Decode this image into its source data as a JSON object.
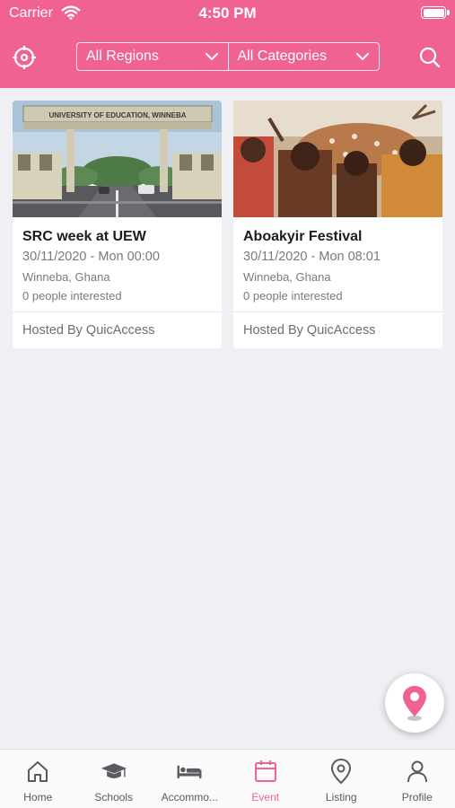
{
  "status_bar": {
    "carrier": "Carrier",
    "time": "4:50 PM"
  },
  "header": {
    "region_filter": "All Regions",
    "category_filter": "All Categories"
  },
  "events": [
    {
      "title": "SRC week at UEW",
      "datetime": "30/11/2020 - Mon 00:00",
      "location": "Winneba, Ghana",
      "interest": "0 people interested",
      "host": "Hosted By QuicAccess",
      "sign_text": "UNIVERSITY OF EDUCATION, WINNEBA"
    },
    {
      "title": "Aboakyir Festival",
      "datetime": "30/11/2020 - Mon 08:01",
      "location": "Winneba, Ghana",
      "interest": "0 people interested",
      "host": "Hosted By QuicAccess"
    }
  ],
  "tabs": [
    {
      "label": "Home",
      "icon": "home-icon"
    },
    {
      "label": "Schools",
      "icon": "graduation-cap-icon"
    },
    {
      "label": "Accommo...",
      "icon": "bed-icon"
    },
    {
      "label": "Event",
      "icon": "calendar-icon",
      "active": true
    },
    {
      "label": "Listing",
      "icon": "map-pin-icon"
    },
    {
      "label": "Profile",
      "icon": "user-icon"
    }
  ],
  "colors": {
    "accent": "#f06292",
    "background": "#efeff4"
  }
}
